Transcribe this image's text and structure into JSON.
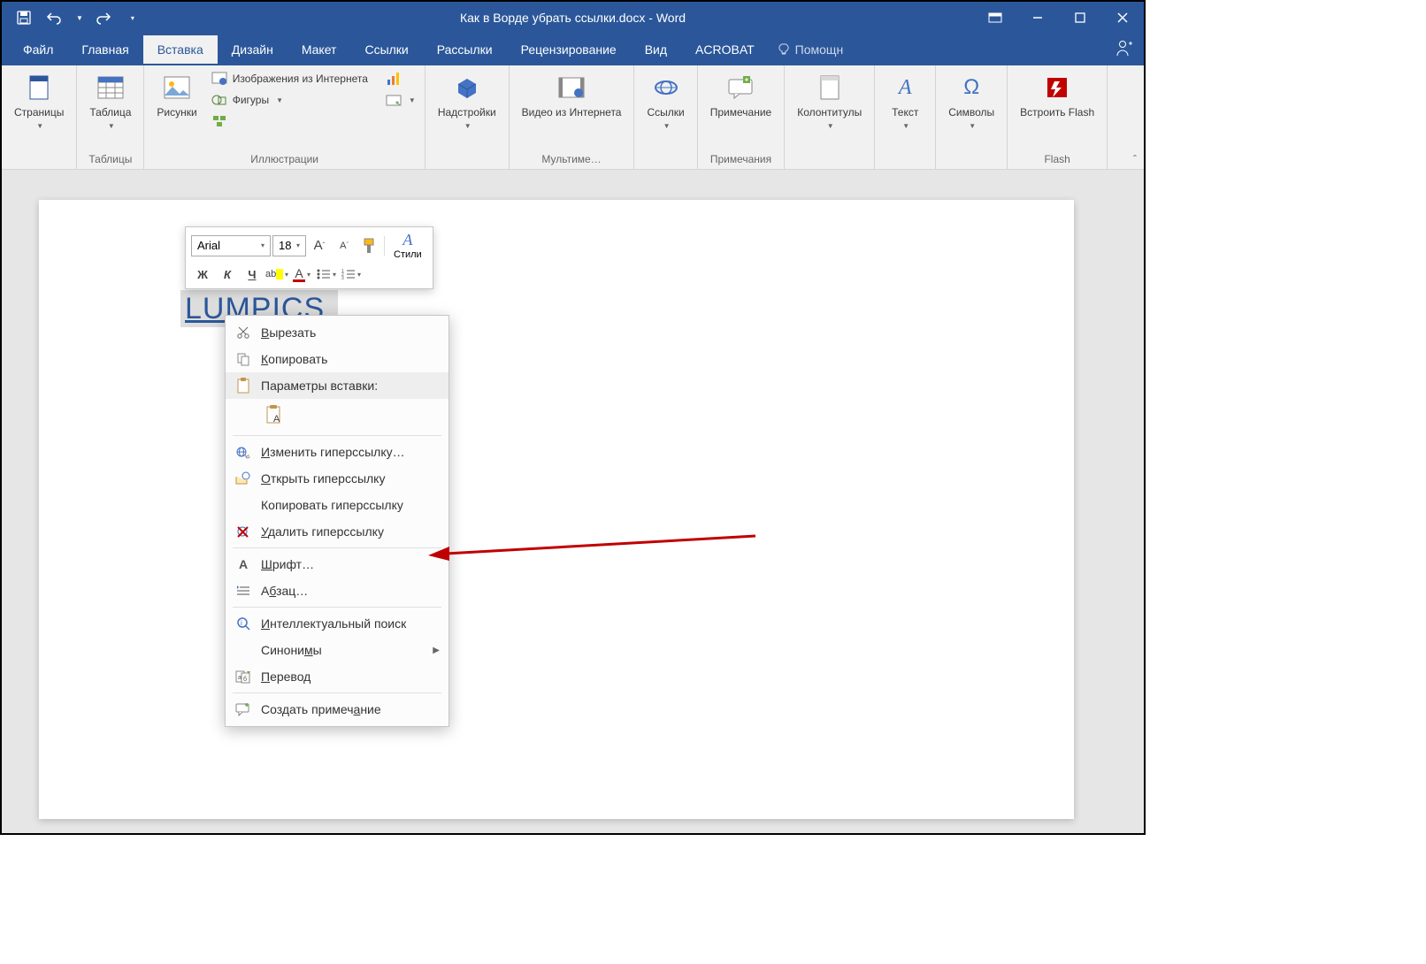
{
  "title": "Как в Ворде убрать ссылки.docx - Word",
  "qat": {
    "save": "save",
    "undo": "undo",
    "redo": "redo"
  },
  "tabs": {
    "file": "Файл",
    "home": "Главная",
    "insert": "Вставка",
    "design": "Дизайн",
    "layout": "Макет",
    "references": "Ссылки",
    "mailings": "Рассылки",
    "review": "Рецензирование",
    "view": "Вид",
    "acrobat": "ACROBAT",
    "tellme": "Помощн"
  },
  "ribbon": {
    "pages": {
      "label": "Страницы",
      "group": ""
    },
    "tables": {
      "label": "Таблица",
      "group": "Таблицы"
    },
    "illustrations": {
      "pictures": "Рисунки",
      "online_pictures": "Изображения из Интернета",
      "shapes": "Фигуры",
      "group": "Иллюстрации"
    },
    "addins": {
      "label": "Надстройки",
      "group": ""
    },
    "media": {
      "label": "Видео из Интернета",
      "group": "Мультиме…"
    },
    "links": {
      "label": "Ссылки",
      "group": ""
    },
    "comments": {
      "label": "Примечание",
      "group": "Примечания"
    },
    "headerfooter": {
      "label": "Колонтитулы",
      "group": ""
    },
    "text": {
      "label": "Текст",
      "group": ""
    },
    "symbols": {
      "label": "Символы",
      "group": ""
    },
    "flash": {
      "label": "Встроить Flash",
      "group": "Flash"
    }
  },
  "document": {
    "hyperlink_text": "LUMPICS"
  },
  "mini_toolbar": {
    "font": "Arial",
    "size": "18",
    "bold": "Ж",
    "italic": "К",
    "underline": "Ч",
    "styles": "Стили"
  },
  "context_menu": {
    "cut": "Вырезать",
    "copy": "Копировать",
    "paste_options": "Параметры вставки:",
    "edit_hyperlink": "Изменить гиперссылку…",
    "open_hyperlink": "Открыть гиперссылку",
    "copy_hyperlink": "Копировать гиперссылку",
    "remove_hyperlink": "Удалить гиперссылку",
    "font": "Шрифт…",
    "paragraph": "Абзац…",
    "smart_lookup": "Интеллектуальный поиск",
    "synonyms": "Синонимы",
    "translate": "Перевод",
    "new_comment": "Создать примечание"
  }
}
